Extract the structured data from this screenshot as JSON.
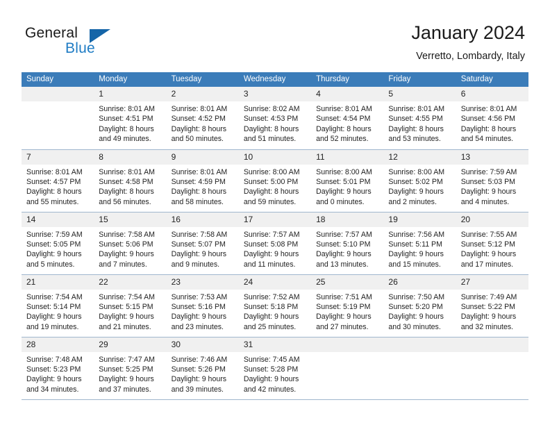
{
  "brand": {
    "name_part1": "General",
    "name_part2": "Blue",
    "logo_icon": "triangle-logo-icon"
  },
  "header": {
    "title": "January 2024",
    "subtitle": "Verretto, Lombardy, Italy"
  },
  "colors": {
    "header_row": "#3b7cb9",
    "daynum_bg": "#f0f0f0",
    "brand_blue": "#1f7cc4",
    "logo_triangle": "#1565a8",
    "cell_border": "#9fb6cd",
    "text": "#222222"
  },
  "weekday_headers": [
    "Sunday",
    "Monday",
    "Tuesday",
    "Wednesday",
    "Thursday",
    "Friday",
    "Saturday"
  ],
  "weeks": [
    [
      {
        "day": "",
        "lines": []
      },
      {
        "day": "1",
        "lines": [
          "Sunrise: 8:01 AM",
          "Sunset: 4:51 PM",
          "Daylight: 8 hours",
          "and 49 minutes."
        ]
      },
      {
        "day": "2",
        "lines": [
          "Sunrise: 8:01 AM",
          "Sunset: 4:52 PM",
          "Daylight: 8 hours",
          "and 50 minutes."
        ]
      },
      {
        "day": "3",
        "lines": [
          "Sunrise: 8:02 AM",
          "Sunset: 4:53 PM",
          "Daylight: 8 hours",
          "and 51 minutes."
        ]
      },
      {
        "day": "4",
        "lines": [
          "Sunrise: 8:01 AM",
          "Sunset: 4:54 PM",
          "Daylight: 8 hours",
          "and 52 minutes."
        ]
      },
      {
        "day": "5",
        "lines": [
          "Sunrise: 8:01 AM",
          "Sunset: 4:55 PM",
          "Daylight: 8 hours",
          "and 53 minutes."
        ]
      },
      {
        "day": "6",
        "lines": [
          "Sunrise: 8:01 AM",
          "Sunset: 4:56 PM",
          "Daylight: 8 hours",
          "and 54 minutes."
        ]
      }
    ],
    [
      {
        "day": "7",
        "lines": [
          "Sunrise: 8:01 AM",
          "Sunset: 4:57 PM",
          "Daylight: 8 hours",
          "and 55 minutes."
        ]
      },
      {
        "day": "8",
        "lines": [
          "Sunrise: 8:01 AM",
          "Sunset: 4:58 PM",
          "Daylight: 8 hours",
          "and 56 minutes."
        ]
      },
      {
        "day": "9",
        "lines": [
          "Sunrise: 8:01 AM",
          "Sunset: 4:59 PM",
          "Daylight: 8 hours",
          "and 58 minutes."
        ]
      },
      {
        "day": "10",
        "lines": [
          "Sunrise: 8:00 AM",
          "Sunset: 5:00 PM",
          "Daylight: 8 hours",
          "and 59 minutes."
        ]
      },
      {
        "day": "11",
        "lines": [
          "Sunrise: 8:00 AM",
          "Sunset: 5:01 PM",
          "Daylight: 9 hours",
          "and 0 minutes."
        ]
      },
      {
        "day": "12",
        "lines": [
          "Sunrise: 8:00 AM",
          "Sunset: 5:02 PM",
          "Daylight: 9 hours",
          "and 2 minutes."
        ]
      },
      {
        "day": "13",
        "lines": [
          "Sunrise: 7:59 AM",
          "Sunset: 5:03 PM",
          "Daylight: 9 hours",
          "and 4 minutes."
        ]
      }
    ],
    [
      {
        "day": "14",
        "lines": [
          "Sunrise: 7:59 AM",
          "Sunset: 5:05 PM",
          "Daylight: 9 hours",
          "and 5 minutes."
        ]
      },
      {
        "day": "15",
        "lines": [
          "Sunrise: 7:58 AM",
          "Sunset: 5:06 PM",
          "Daylight: 9 hours",
          "and 7 minutes."
        ]
      },
      {
        "day": "16",
        "lines": [
          "Sunrise: 7:58 AM",
          "Sunset: 5:07 PM",
          "Daylight: 9 hours",
          "and 9 minutes."
        ]
      },
      {
        "day": "17",
        "lines": [
          "Sunrise: 7:57 AM",
          "Sunset: 5:08 PM",
          "Daylight: 9 hours",
          "and 11 minutes."
        ]
      },
      {
        "day": "18",
        "lines": [
          "Sunrise: 7:57 AM",
          "Sunset: 5:10 PM",
          "Daylight: 9 hours",
          "and 13 minutes."
        ]
      },
      {
        "day": "19",
        "lines": [
          "Sunrise: 7:56 AM",
          "Sunset: 5:11 PM",
          "Daylight: 9 hours",
          "and 15 minutes."
        ]
      },
      {
        "day": "20",
        "lines": [
          "Sunrise: 7:55 AM",
          "Sunset: 5:12 PM",
          "Daylight: 9 hours",
          "and 17 minutes."
        ]
      }
    ],
    [
      {
        "day": "21",
        "lines": [
          "Sunrise: 7:54 AM",
          "Sunset: 5:14 PM",
          "Daylight: 9 hours",
          "and 19 minutes."
        ]
      },
      {
        "day": "22",
        "lines": [
          "Sunrise: 7:54 AM",
          "Sunset: 5:15 PM",
          "Daylight: 9 hours",
          "and 21 minutes."
        ]
      },
      {
        "day": "23",
        "lines": [
          "Sunrise: 7:53 AM",
          "Sunset: 5:16 PM",
          "Daylight: 9 hours",
          "and 23 minutes."
        ]
      },
      {
        "day": "24",
        "lines": [
          "Sunrise: 7:52 AM",
          "Sunset: 5:18 PM",
          "Daylight: 9 hours",
          "and 25 minutes."
        ]
      },
      {
        "day": "25",
        "lines": [
          "Sunrise: 7:51 AM",
          "Sunset: 5:19 PM",
          "Daylight: 9 hours",
          "and 27 minutes."
        ]
      },
      {
        "day": "26",
        "lines": [
          "Sunrise: 7:50 AM",
          "Sunset: 5:20 PM",
          "Daylight: 9 hours",
          "and 30 minutes."
        ]
      },
      {
        "day": "27",
        "lines": [
          "Sunrise: 7:49 AM",
          "Sunset: 5:22 PM",
          "Daylight: 9 hours",
          "and 32 minutes."
        ]
      }
    ],
    [
      {
        "day": "28",
        "lines": [
          "Sunrise: 7:48 AM",
          "Sunset: 5:23 PM",
          "Daylight: 9 hours",
          "and 34 minutes."
        ]
      },
      {
        "day": "29",
        "lines": [
          "Sunrise: 7:47 AM",
          "Sunset: 5:25 PM",
          "Daylight: 9 hours",
          "and 37 minutes."
        ]
      },
      {
        "day": "30",
        "lines": [
          "Sunrise: 7:46 AM",
          "Sunset: 5:26 PM",
          "Daylight: 9 hours",
          "and 39 minutes."
        ]
      },
      {
        "day": "31",
        "lines": [
          "Sunrise: 7:45 AM",
          "Sunset: 5:28 PM",
          "Daylight: 9 hours",
          "and 42 minutes."
        ]
      },
      {
        "day": "",
        "lines": []
      },
      {
        "day": "",
        "lines": []
      },
      {
        "day": "",
        "lines": []
      }
    ]
  ]
}
